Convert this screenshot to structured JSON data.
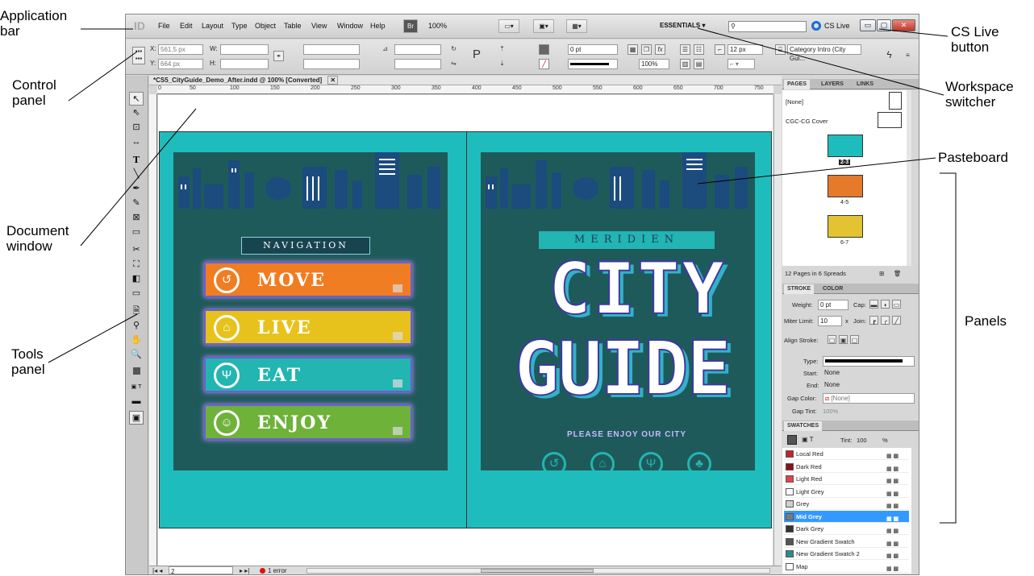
{
  "callouts": {
    "application_bar": [
      "Application",
      "bar"
    ],
    "control_panel": [
      "Control",
      "panel"
    ],
    "document_window": [
      "Document",
      "window"
    ],
    "tools_panel": [
      "Tools",
      "panel"
    ],
    "cs_live_button": [
      "CS Live",
      "button"
    ],
    "workspace_switcher": [
      "Workspace",
      "switcher"
    ],
    "pasteboard": "Pasteboard",
    "panels": "Panels"
  },
  "menubar": {
    "items": [
      "File",
      "Edit",
      "Layout",
      "Type",
      "Object",
      "Table",
      "View",
      "Window",
      "Help"
    ],
    "bridge": "Br",
    "zoom": "100%",
    "workspace": "ESSENTIALS",
    "cs_live": "CS Live"
  },
  "control": {
    "x_label": "X:",
    "x_value": "561.5 px",
    "y_label": "Y:",
    "y_value": "664 px",
    "w_label": "W:",
    "h_label": "H:",
    "stroke_weight": "0 pt",
    "percent": "100%",
    "font_size": "12 px",
    "style": "Category Intro (City Gui..."
  },
  "document": {
    "tab_title": "*CS5_CityGuide_Demo_After.indd @ 100% [Converted]",
    "ruler_ticks": [
      "0",
      "50",
      "100",
      "150",
      "200",
      "250",
      "300",
      "350",
      "400",
      "450",
      "500",
      "550",
      "600",
      "650",
      "700",
      "750",
      "800",
      "850",
      "900"
    ],
    "page_number": "2",
    "status_errors": "1 error"
  },
  "artwork": {
    "navigation_title": "NAVIGATION",
    "nav_buttons": [
      {
        "label": "MOVE",
        "color": "#f07d22"
      },
      {
        "label": "LIVE",
        "color": "#e7c21c"
      },
      {
        "label": "EAT",
        "color": "#22b5b2"
      },
      {
        "label": "ENJOY",
        "color": "#6fb23a"
      }
    ],
    "meridien": "MERIDIEN",
    "city": "CITY",
    "guide": "GUIDE",
    "tagline": "PLEASE ENJOY OUR CITY",
    "teal": "#1fbcbd",
    "dark": "#1f5a5b"
  },
  "pages_panel": {
    "tabs": [
      "PAGES",
      "LAYERS",
      "LINKS"
    ],
    "masters": [
      "[None]",
      "CGC-CG Cover"
    ],
    "spreads": [
      "2-3",
      "4-5",
      "6-7"
    ],
    "footer": "12 Pages in 6 Spreads"
  },
  "stroke_panel": {
    "tabs": [
      "STROKE",
      "COLOR"
    ],
    "weight_label": "Weight:",
    "weight": "0 pt",
    "cap_label": "Cap:",
    "miter_label": "Miter Limit:",
    "miter": "10",
    "x": "x",
    "join_label": "Join:",
    "align_label": "Align Stroke:",
    "type_label": "Type:",
    "start_label": "Start:",
    "start": "None",
    "end_label": "End:",
    "end": "None",
    "gap_color_label": "Gap Color:",
    "gap_color": "[None]",
    "gap_tint_label": "Gap Tint:",
    "gap_tint": "100%"
  },
  "swatches_panel": {
    "title": "SWATCHES",
    "tint_label": "Tint:",
    "tint": "100",
    "pct": "%",
    "swatches": [
      {
        "name": "Local Red",
        "color": "#c8202a"
      },
      {
        "name": "Dark Red",
        "color": "#8c1116"
      },
      {
        "name": "Light Red",
        "color": "#e0444c"
      },
      {
        "name": "Light Grey",
        "color": "#ffffff"
      },
      {
        "name": "Grey",
        "color": "#cfcfcf"
      },
      {
        "name": "Mid Grey",
        "color": "#7b7b7b"
      },
      {
        "name": "Dark Grey",
        "color": "#333333"
      },
      {
        "name": "New Gradient Swatch",
        "color": "#555555"
      },
      {
        "name": "New Gradient Swatch 2",
        "color": "#2c8b8c"
      },
      {
        "name": "Map",
        "color": "#ffffff"
      }
    ],
    "selected_index": 5
  }
}
